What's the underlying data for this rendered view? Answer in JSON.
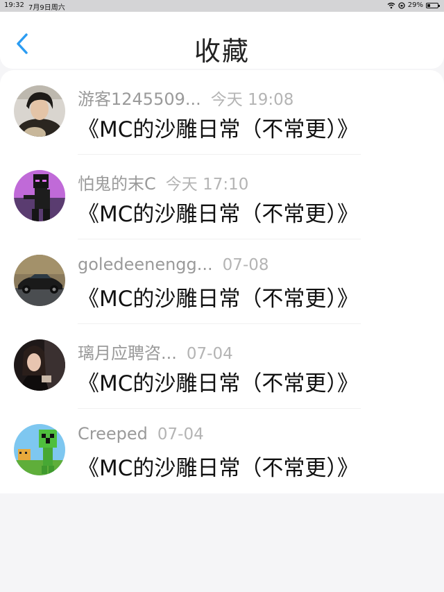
{
  "status_bar": {
    "time": "19:32",
    "date": "7月9日周六",
    "battery": "29%",
    "battery_level": 0.29
  },
  "header": {
    "title": "收藏"
  },
  "items": [
    {
      "user": "游客1245509...",
      "time": "今天 19:08",
      "title": "《MC的沙雕日常（不常更）》",
      "avatar": "avatar-person-icon"
    },
    {
      "user": "怕鬼的末C",
      "time": "今天 17:10",
      "title": "《MC的沙雕日常（不常更）》",
      "avatar": "avatar-enderman-icon"
    },
    {
      "user": "goledeenengg...",
      "time": "07-08",
      "title": "《MC的沙雕日常（不常更）》",
      "avatar": "avatar-sports-car-icon"
    },
    {
      "user": "璃月应聘咨...",
      "time": "07-04",
      "title": "《MC的沙雕日常（不常更）》",
      "avatar": "avatar-girl-icon"
    },
    {
      "user": "Creeped",
      "time": "07-04",
      "title": "《MC的沙雕日常（不常更）》",
      "avatar": "avatar-creeper-icon"
    }
  ],
  "colors": {
    "accent": "#2b9cf2",
    "username": "#9a9a9a",
    "time": "#b4b4b4"
  }
}
